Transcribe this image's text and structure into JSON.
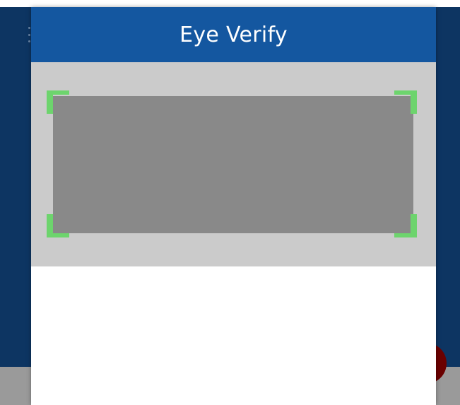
{
  "dialog": {
    "title": "Eye Verify"
  },
  "scanner": {
    "frame_color": "#6dd46d",
    "preview_state": "empty"
  },
  "colors": {
    "header": "#1457a0",
    "background_app": "#0d3562",
    "fab": "#6b0000"
  },
  "icons": {
    "overflow_menu": "overflow-menu-icon"
  }
}
